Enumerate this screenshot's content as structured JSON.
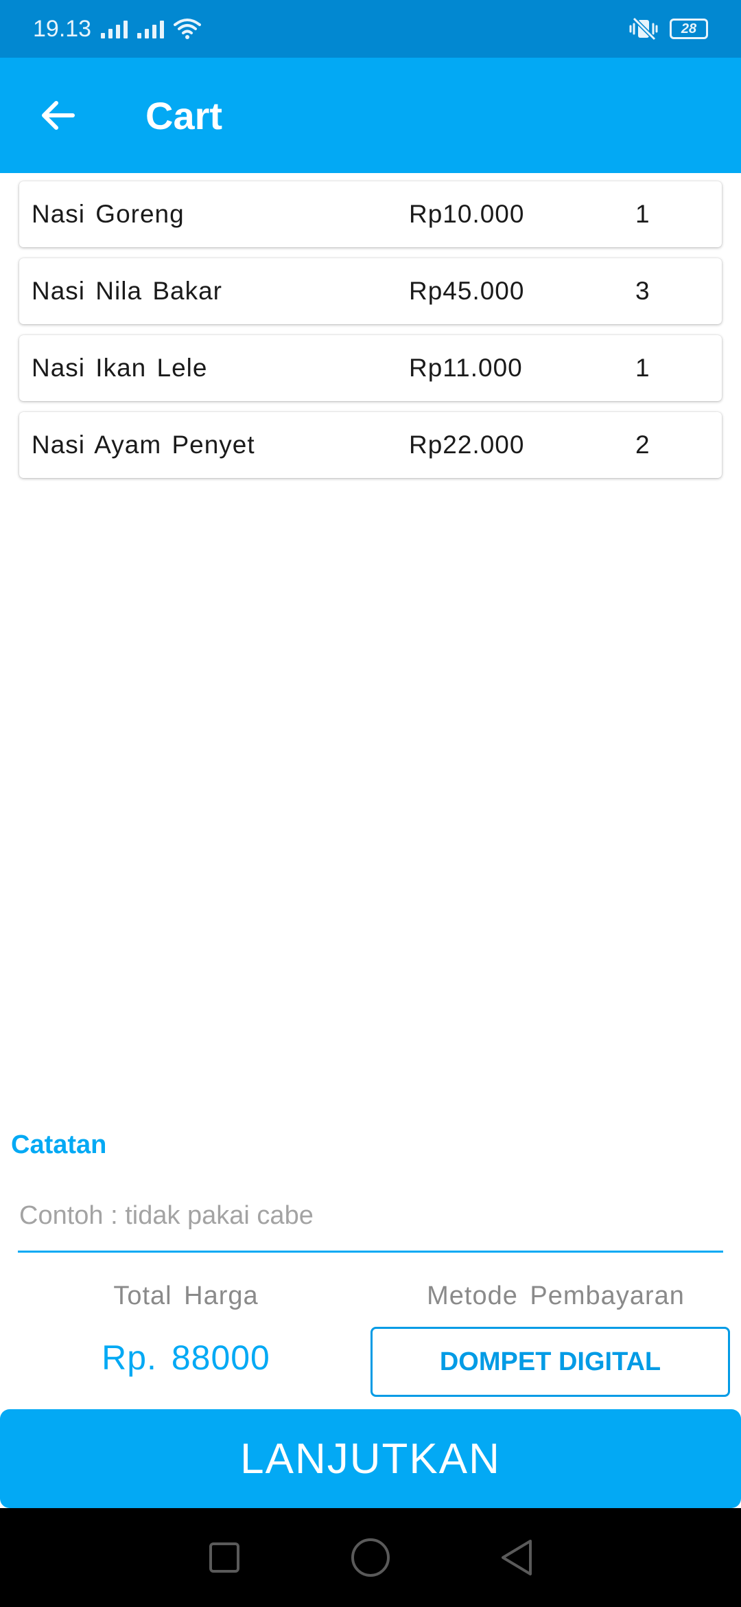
{
  "status_bar": {
    "time": "19.13",
    "battery": "28"
  },
  "app_bar": {
    "title": "Cart"
  },
  "cart": {
    "items": [
      {
        "name": "Nasi  Goreng",
        "price": "Rp10.000",
        "qty": "1"
      },
      {
        "name": "Nasi  Nila  Bakar",
        "price": "Rp45.000",
        "qty": "3"
      },
      {
        "name": "Nasi  Ikan  Lele",
        "price": "Rp11.000",
        "qty": "1"
      },
      {
        "name": "Nasi  Ayam  Penyet",
        "price": "Rp22.000",
        "qty": "2"
      }
    ]
  },
  "notes": {
    "label": "Catatan",
    "placeholder": "Contoh : tidak pakai cabe",
    "value": ""
  },
  "summary": {
    "total_label": "Total  Harga",
    "total_value": "Rp.  88000",
    "payment_label": "Metode  Pembayaran",
    "payment_button": "DOMPET DIGITAL"
  },
  "actions": {
    "continue_label": "LANJUTKAN"
  },
  "colors": {
    "primary": "#03a9f4",
    "status_bar": "#0288d1"
  },
  "icons": {
    "back": "arrow-back-icon",
    "nav_recent": "square-icon",
    "nav_home": "circle-icon",
    "nav_back": "triangle-icon"
  }
}
